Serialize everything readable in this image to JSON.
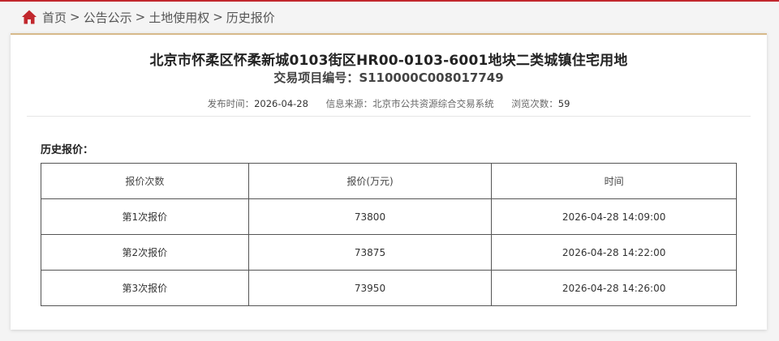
{
  "colors": {
    "accent_red": "#c1272d",
    "card_top_border": "#d7b98a"
  },
  "breadcrumb": {
    "icon": "home-icon",
    "items": [
      "首页",
      "公告公示",
      "土地使用权",
      "历史报价"
    ],
    "separator": ">"
  },
  "header": {
    "title": "北京市怀柔区怀柔新城0103街区HR00-0103-6001地块二类城镇住宅用地",
    "project_label": "交易项目编号：",
    "project_code": "S110000C008017749"
  },
  "meta": {
    "publish_label": "发布时间：",
    "publish_date": "2026-04-28",
    "source_label": "信息来源：",
    "source": "北京市公共资源综合交易系统",
    "views_label": "浏览次数：",
    "views": "59"
  },
  "history": {
    "heading": "历史报价：",
    "columns": [
      "报价次数",
      "报价(万元)",
      "时间"
    ],
    "rows": [
      [
        "第1次报价",
        "73800",
        "2026-04-28 14:09:00"
      ],
      [
        "第2次报价",
        "73875",
        "2026-04-28 14:22:00"
      ],
      [
        "第3次报价",
        "73950",
        "2026-04-28 14:26:00"
      ]
    ]
  }
}
